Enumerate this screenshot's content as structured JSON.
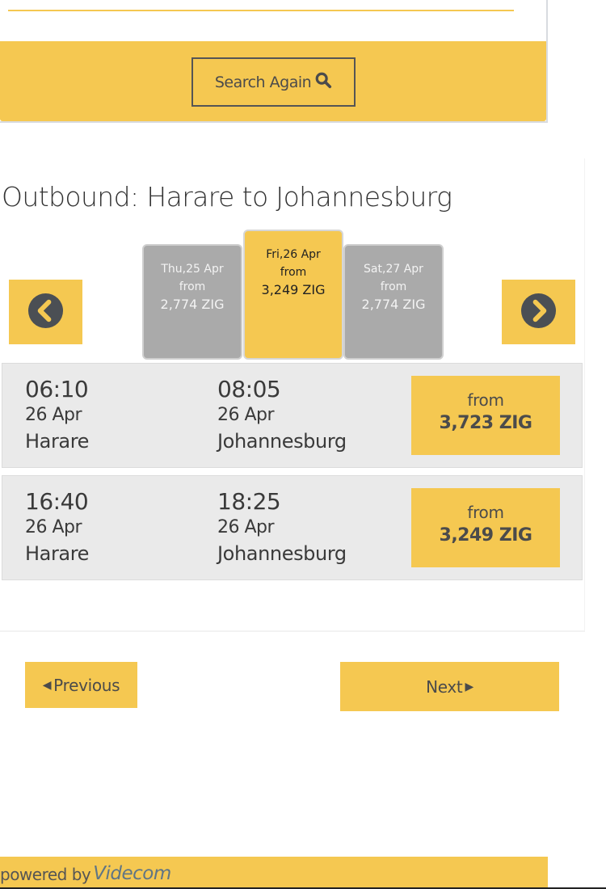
{
  "search": {
    "search_again_label": "Search Again",
    "search_icon": "search-icon"
  },
  "outbound": {
    "title": "Outbound: Harare to Johannesburg",
    "prev_icon": "chevron-circle-left-icon",
    "next_icon": "chevron-circle-right-icon",
    "date_tabs": [
      {
        "date": "Thu,25 Apr",
        "from_label": "from",
        "price": "2,774 ZIG",
        "selected": false
      },
      {
        "date": "Fri,26 Apr",
        "from_label": "from",
        "price": "3,249 ZIG",
        "selected": true
      },
      {
        "date": "Sat,27 Apr",
        "from_label": "from",
        "price": "2,774 ZIG",
        "selected": false
      }
    ],
    "flights": [
      {
        "departure": {
          "time": "06:10",
          "date": "26 Apr",
          "city": "Harare"
        },
        "arrival": {
          "time": "08:05",
          "date": "26 Apr",
          "city": "Johannesburg"
        },
        "from_label": "from",
        "price": "3,723 ZIG"
      },
      {
        "departure": {
          "time": "16:40",
          "date": "26 Apr",
          "city": "Harare"
        },
        "arrival": {
          "time": "18:25",
          "date": "26 Apr",
          "city": "Johannesburg"
        },
        "from_label": "from",
        "price": "3,249 ZIG"
      }
    ]
  },
  "pager": {
    "previous_label": "Previous",
    "next_label": "Next"
  },
  "footer": {
    "powered_by": "powered by",
    "brand": "Videcom"
  },
  "colors": {
    "accent": "#f5c851",
    "inactive_tab": "#aaaaaa",
    "row_bg": "#eaeaea",
    "text_dark": "#4b4b4b"
  }
}
